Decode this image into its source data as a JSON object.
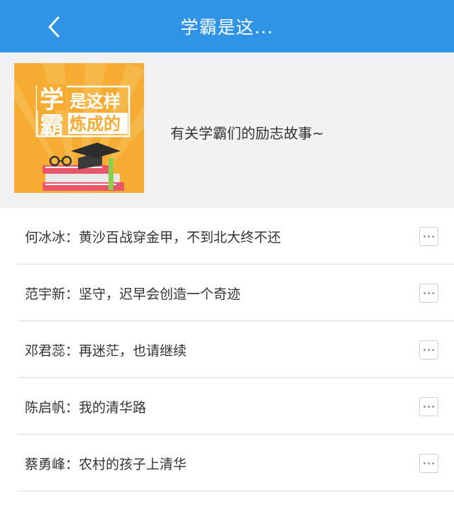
{
  "header": {
    "title": "学霸是这..."
  },
  "banner": {
    "cover": {
      "big_char_1": "学",
      "big_char_2": "霸",
      "line1": "是这样",
      "line2": "炼成的",
      "background_color": "#f6ac33"
    },
    "description": "有关学霸们的励志故事~"
  },
  "list": {
    "items": [
      {
        "text": "何冰冰：黄沙百战穿金甲，不到北大终不还"
      },
      {
        "text": "范宇新：坚守，迟早会创造一个奇迹"
      },
      {
        "text": "邓君蕊：再迷茫，也请继续"
      },
      {
        "text": "陈启帆：我的清华路"
      },
      {
        "text": "蔡勇峰：农村的孩子上清华"
      }
    ]
  },
  "colors": {
    "header_bg": "#2f93e6",
    "banner_bg": "#f2f2f5",
    "divider": "#dcdcdc"
  }
}
